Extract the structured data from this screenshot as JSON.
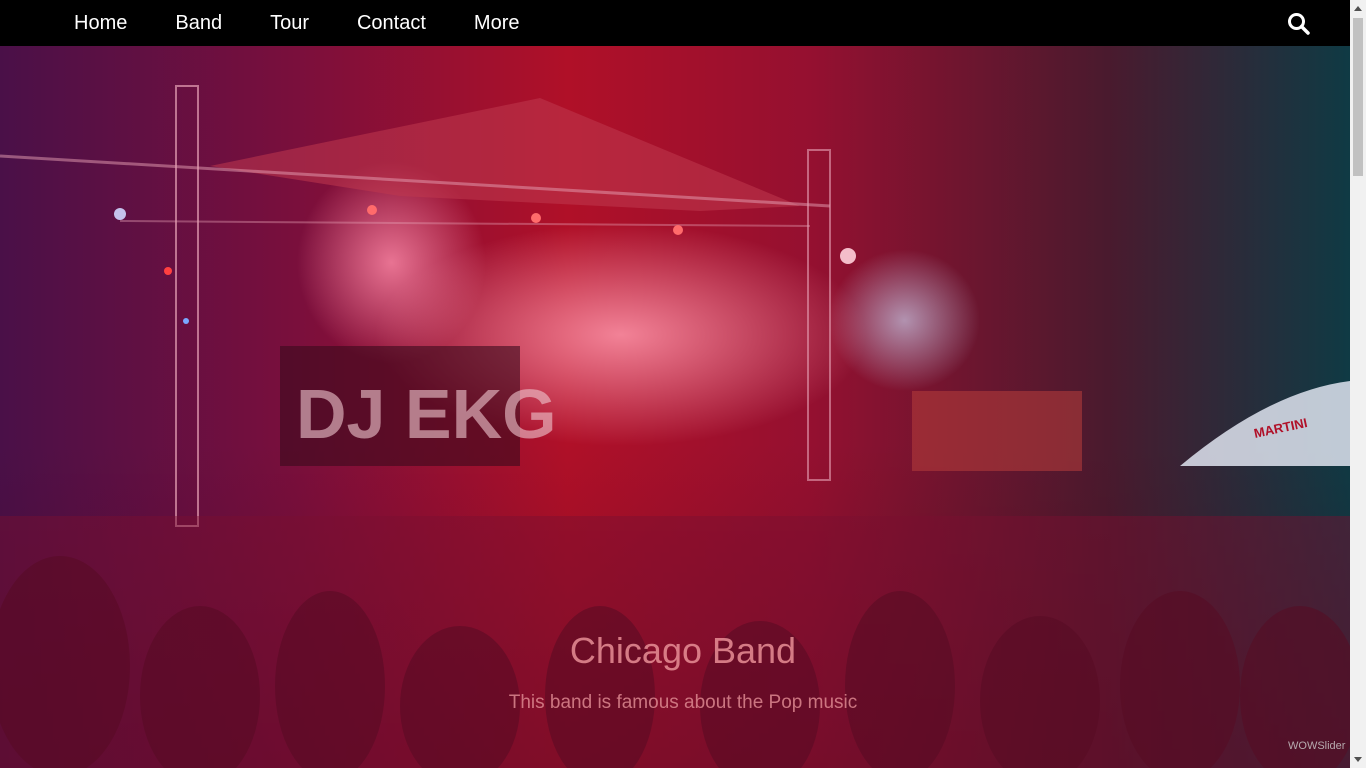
{
  "nav": {
    "items": [
      {
        "label": "Home"
      },
      {
        "label": "Band"
      },
      {
        "label": "Tour"
      },
      {
        "label": "Contact"
      },
      {
        "label": "More"
      }
    ],
    "search_icon": "search-icon"
  },
  "hero": {
    "title": "Chicago Band",
    "subtitle": "This band is famous about the Pop music",
    "stage_sign": "DJ EKG",
    "umbrella_text": "MARTINI",
    "watermark": "WOWSlider"
  },
  "colors": {
    "nav_bg": "#000000",
    "nav_text": "#ffffff",
    "overlay_left": "#4a1048",
    "overlay_center": "#b01028",
    "overlay_right": "#0f3a44"
  }
}
